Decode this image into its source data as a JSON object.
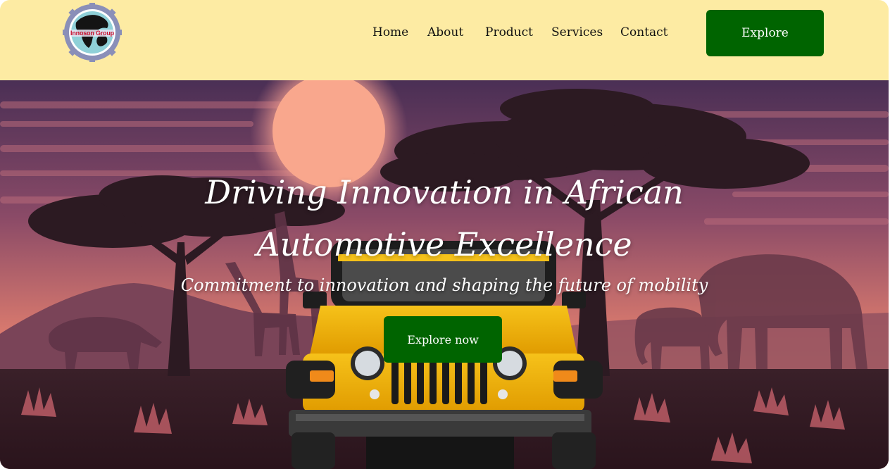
{
  "header": {
    "logo": {
      "text": "Innoson Group",
      "icon": "globe-gear-logo"
    },
    "nav": [
      {
        "label": "Home"
      },
      {
        "label": "About"
      },
      {
        "label": "Product"
      },
      {
        "label": "Services"
      },
      {
        "label": "Contact"
      }
    ],
    "cta_label": "Explore",
    "background": "#fdeba3",
    "cta_color": "#006400"
  },
  "hero": {
    "title_line1": "Driving Innovation in African",
    "title_line2": "Automotive Excellence",
    "subtitle": "Commitment to innovation and shaping the future of mobility",
    "cta_label": "Explore now",
    "cta_color": "#006400",
    "image_icon": "african-savanna-jeep-illustration"
  }
}
